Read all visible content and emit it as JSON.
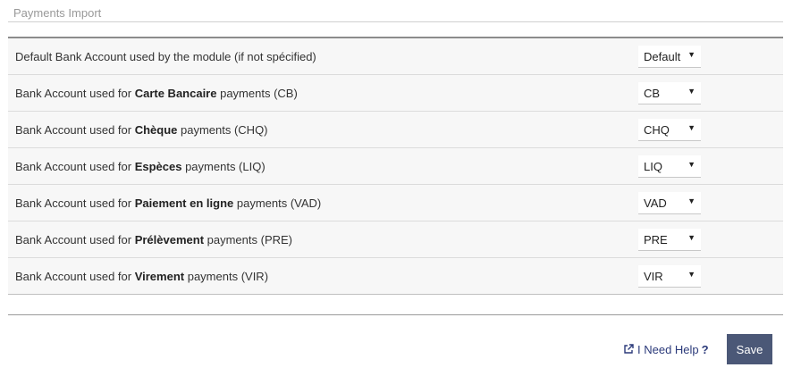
{
  "section": {
    "title": "Payments Import"
  },
  "rows": [
    {
      "prefix": "Default Bank Account used by the module (if not spécified)",
      "bold": "",
      "suffix": "",
      "value": "Default"
    },
    {
      "prefix": "Bank Account used for ",
      "bold": "Carte Bancaire",
      "suffix": " payments (CB)",
      "value": "CB"
    },
    {
      "prefix": "Bank Account used for ",
      "bold": "Chèque",
      "suffix": " payments (CHQ)",
      "value": "CHQ"
    },
    {
      "prefix": "Bank Account used for ",
      "bold": "Espèces",
      "suffix": " payments (LIQ)",
      "value": "LIQ"
    },
    {
      "prefix": "Bank Account used for ",
      "bold": "Paiement en ligne",
      "suffix": " payments (VAD)",
      "value": "VAD"
    },
    {
      "prefix": "Bank Account used for ",
      "bold": "Prélèvement",
      "suffix": " payments (PRE)",
      "value": "PRE"
    },
    {
      "prefix": "Bank Account used for ",
      "bold": "Virement",
      "suffix": " payments (VIR)",
      "value": "VIR"
    }
  ],
  "footer": {
    "help_label": "I Need Help",
    "help_mark": "?",
    "save_label": "Save"
  },
  "icons": {
    "select_arrow": "dropdown-arrow-icon",
    "help_link": "external-link-icon"
  },
  "colors": {
    "save_button": "#4b5877",
    "help_link": "#2b3a7a",
    "row_bg": "#f7f7f7"
  }
}
